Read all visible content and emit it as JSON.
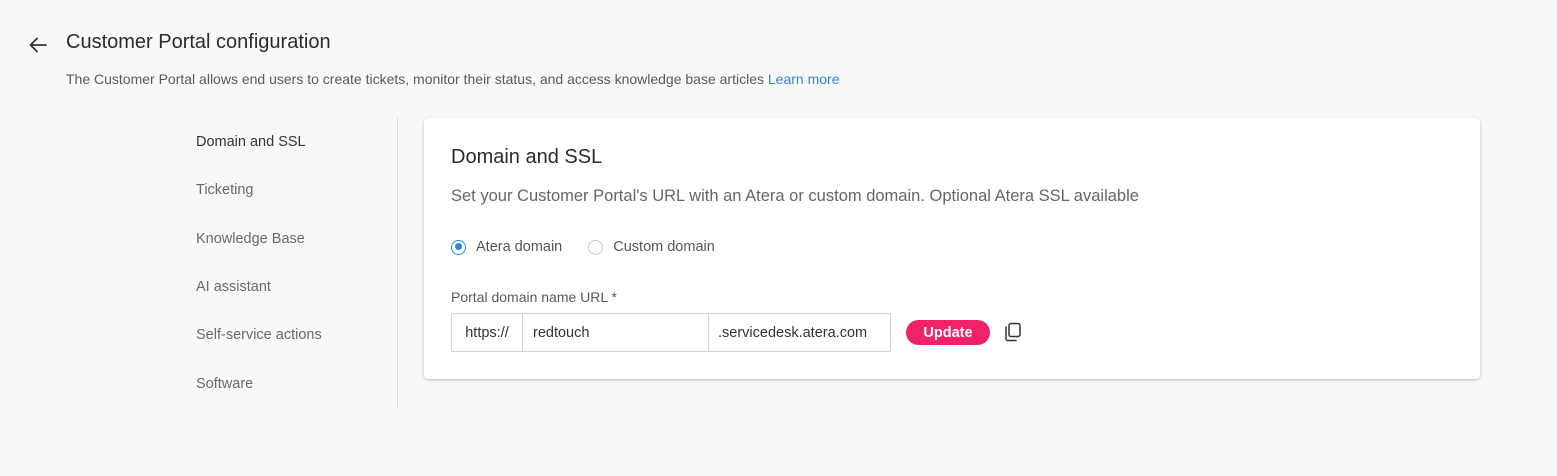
{
  "header": {
    "title": "Customer Portal configuration",
    "description": "The Customer Portal allows end users to create tickets, monitor their status, and access knowledge base articles",
    "learn_more": "Learn more"
  },
  "nav": {
    "items": [
      {
        "label": "Domain and SSL",
        "active": true
      },
      {
        "label": "Ticketing",
        "active": false
      },
      {
        "label": "Knowledge Base",
        "active": false
      },
      {
        "label": "AI assistant",
        "active": false
      },
      {
        "label": "Self-service actions",
        "active": false
      },
      {
        "label": "Software",
        "active": false
      }
    ]
  },
  "section": {
    "title": "Domain and SSL",
    "description": "Set your Customer Portal's URL with an Atera or custom domain. Optional Atera SSL available",
    "radio_options": [
      {
        "label": "Atera domain",
        "checked": true
      },
      {
        "label": "Custom domain",
        "checked": false
      }
    ],
    "field_label": "Portal domain name URL *",
    "url_prefix": "https://",
    "url_value": "redtouch",
    "url_suffix": ".servicedesk.atera.com",
    "update_label": "Update",
    "copy_icon": "copy-icon"
  },
  "colors": {
    "accent_blue": "#2a88d8",
    "update_pink": "#f0226a",
    "background": "#f8f8f8"
  }
}
